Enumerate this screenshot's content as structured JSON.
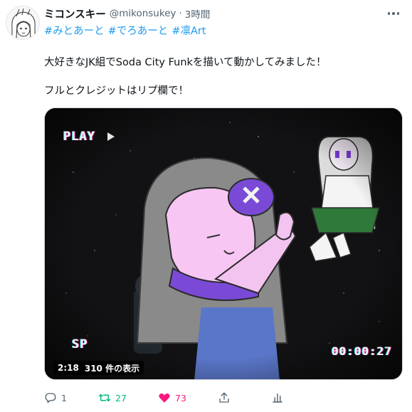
{
  "tweet": {
    "display_name": "ミコンスキー",
    "handle": "@mikonsukey",
    "separator": "·",
    "time": "3時間",
    "hashtags": [
      "#みとあーと",
      "#でろあーと",
      "#凛Art"
    ],
    "text_line_1": "大好きなJK組でSoda City Funkを描いて動かしてみました！",
    "text_line_2": "フルとクレジットはリプ欄で！"
  },
  "media": {
    "overlay_play": "PLAY",
    "overlay_sp": "SP",
    "overlay_counter": "00:00:27",
    "duration": "2:18",
    "views": "310 件の表示"
  },
  "actions": {
    "reply_count": "1",
    "retweet_count": "27",
    "like_count": "73"
  },
  "colors": {
    "link": "#1d9bf0",
    "retweet_active": "#00ba7c",
    "like_active": "#f91880",
    "muted": "#536471"
  },
  "icons": [
    "more-dots-icon",
    "play-triangle-icon",
    "reply-icon",
    "retweet-icon",
    "heart-icon",
    "share-icon",
    "analytics-icon"
  ]
}
